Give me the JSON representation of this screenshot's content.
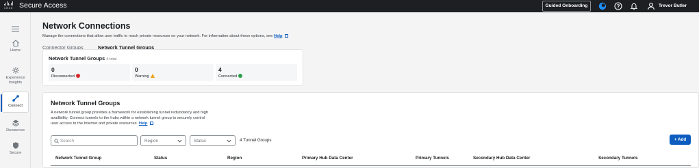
{
  "topbar": {
    "logo_text": "cisco",
    "app_title": "Secure Access",
    "guided_onboarding_label": "Guided Onboarding",
    "user_name": "Trevor Butler",
    "icons": [
      "cisco-ai-assistant-icon",
      "help-icon",
      "notifications-icon",
      "user-icon"
    ]
  },
  "sidebar": {
    "menu_icon": "hamburger-icon",
    "items": [
      {
        "label": "Home",
        "icon": "home-icon"
      },
      {
        "label": "Experience Insights",
        "icon": "insights-icon"
      },
      {
        "label": "Connect",
        "icon": "connect-icon",
        "active": true
      },
      {
        "label": "Resources",
        "icon": "resources-icon"
      },
      {
        "label": "Secure",
        "icon": "shield-icon"
      }
    ]
  },
  "page": {
    "title": "Network Connections",
    "description": "Manage the connections that allow user traffic to reach private resources on your network. For information about these options, see",
    "help_link": "Help"
  },
  "tabs": [
    "Connector Groups",
    "Network Tunnel Groups"
  ],
  "summary": {
    "title": "Network Tunnel Groups",
    "total_label": "4 total",
    "stats": [
      {
        "value": "0",
        "label": "Disconnected",
        "status": "error"
      },
      {
        "value": "0",
        "label": "Warning",
        "status": "warning"
      },
      {
        "value": "4",
        "label": "Connected",
        "status": "success"
      }
    ]
  },
  "tunnel_groups": {
    "title": "Network Tunnel Groups",
    "description_1": "A network tunnel group provides a framework for establishing tunnel redundancy and high",
    "description_2": "availibility. Connect tunnels to the hubs within a network tunnel group to securely control",
    "description_3": "user access to the Internet and private resources.",
    "help_link": "Help",
    "search_placeholder": "Search",
    "region_placeholder": "Region",
    "status_placeholder": "Status",
    "count_text": "4 Tunnel Groups",
    "add_label": "+ Add",
    "columns": [
      "Network Tunnel Group",
      "Status",
      "Region",
      "Primary Hub Data Center",
      "Primary Tunnels",
      "Secondary Hub Data Center",
      "Secondary Tunnels"
    ]
  },
  "colors": {
    "topbar_bg": "#1d1f22",
    "accent": "#0d5cbf",
    "error": "#d62b2b",
    "warning": "#f0a014",
    "success": "#2d9e4b"
  }
}
